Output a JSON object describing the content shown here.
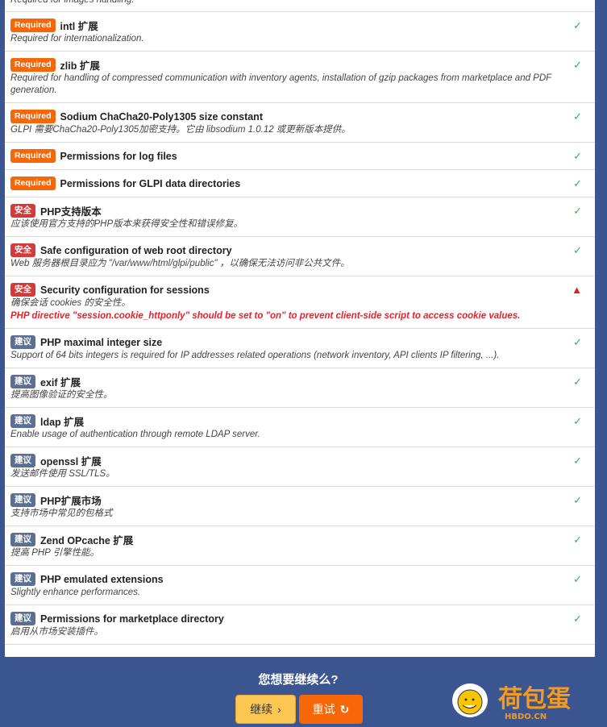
{
  "rows": [
    {
      "badge": "",
      "title": "",
      "desc": "Required for images handling.",
      "status": "ok"
    },
    {
      "badge": "Required",
      "title": "intl 扩展",
      "desc": "Required for internationalization.",
      "status": "ok"
    },
    {
      "badge": "Required",
      "title": "zlib 扩展",
      "desc": "Required for handling of compressed communication with inventory agents, installation of gzip packages from marketplace and PDF generation.",
      "status": "ok"
    },
    {
      "badge": "Required",
      "title": "Sodium ChaCha20-Poly1305 size constant",
      "desc": "GLPI 需要ChaCha20-Poly1305加密支持。它由 libsodium 1.0.12 或更新版本提供。",
      "status": "ok"
    },
    {
      "badge": "Required",
      "title": "Permissions for log files",
      "desc": "",
      "status": "ok"
    },
    {
      "badge": "Required",
      "title": "Permissions for GLPI data directories",
      "desc": "",
      "status": "ok"
    },
    {
      "badge": "安全",
      "title": "PHP支持版本",
      "desc": "应该使用官方支持的PHP版本来获得安全性和错误修复。",
      "status": "ok"
    },
    {
      "badge": "安全",
      "title": "Safe configuration of web root directory",
      "desc": "Web 服务器根目录应为 \"/var/www/html/glpi/public\" ，以确保无法访问非公共文件。",
      "status": "ok"
    },
    {
      "badge": "安全",
      "title": "Security configuration for sessions",
      "desc": "确保会话 cookies 的安全性。",
      "error": "PHP directive \"session.cookie_httponly\" should be set to \"on\" to prevent client-side script to access cookie values.",
      "status": "warning"
    },
    {
      "badge": "建议",
      "title": "PHP maximal integer size",
      "desc": "Support of 64 bits integers is required for IP addresses related operations (network inventory, API clients IP filtering, ...).",
      "status": "ok"
    },
    {
      "badge": "建议",
      "title": "exif 扩展",
      "desc": "提高图像验证的安全性。",
      "status": "ok"
    },
    {
      "badge": "建议",
      "title": "ldap 扩展",
      "desc": "Enable usage of authentication through remote LDAP server.",
      "status": "ok"
    },
    {
      "badge": "建议",
      "title": "openssl 扩展",
      "desc": "发送邮件使用 SSL/TLS。",
      "status": "ok"
    },
    {
      "badge": "建议",
      "title": "PHP扩展市场",
      "desc": "支持市场中常见的包格式",
      "status": "ok"
    },
    {
      "badge": "建议",
      "title": "Zend OPcache 扩展",
      "desc": "提高 PHP 引擎性能。",
      "status": "ok"
    },
    {
      "badge": "建议",
      "title": "PHP emulated extensions",
      "desc": "Slightly enhance performances.",
      "status": "ok"
    },
    {
      "badge": "建议",
      "title": "Permissions for marketplace directory",
      "desc": "启用从市场安装插件。",
      "status": "ok"
    }
  ],
  "footer": {
    "question": "您想要继续么?",
    "continue_label": "继续",
    "retry_label": "重试"
  },
  "logo": {
    "text": "荷包蛋",
    "domain": "HBDO.CN"
  },
  "colors": {
    "background": "#3a5590",
    "required": "#f76707",
    "security": "#d63939",
    "suggested": "#5c6e91",
    "ok": "#2fb344",
    "error": "#e8202a"
  }
}
